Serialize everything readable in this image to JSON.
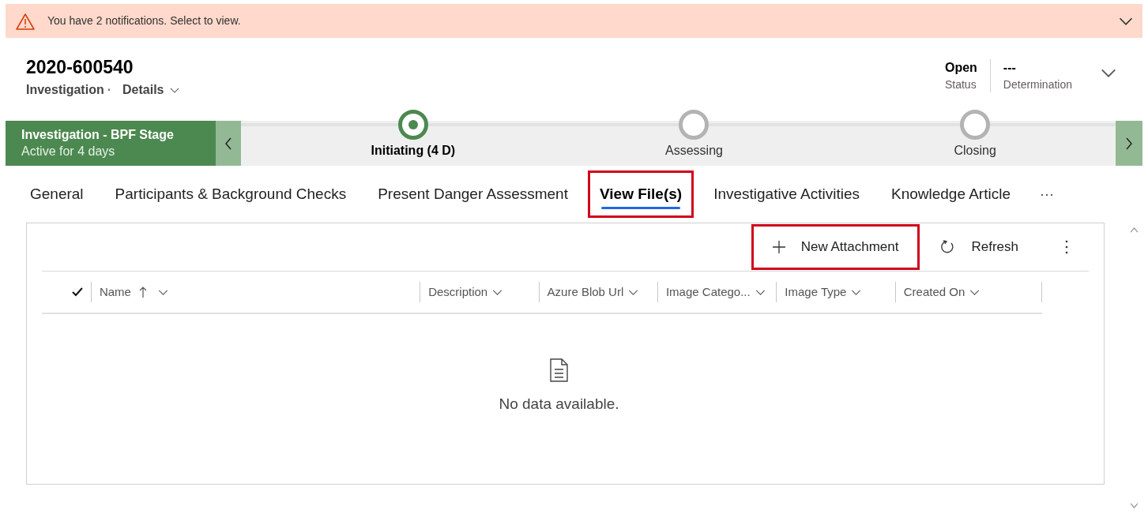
{
  "notification": {
    "text": "You have 2 notifications. Select to view."
  },
  "record": {
    "title": "2020-600540",
    "entity": "Investigation",
    "separator": "·",
    "form": "Details"
  },
  "header_fields": [
    {
      "value": "Open",
      "label": "Status"
    },
    {
      "value": "---",
      "label": "Determination"
    }
  ],
  "process": {
    "name": "Investigation - BPF Stage",
    "duration": "Active for 4 days",
    "stages": [
      {
        "label": "Initiating  (4 D)",
        "selected": true
      },
      {
        "label": "Assessing",
        "selected": false
      },
      {
        "label": "Closing",
        "selected": false
      }
    ]
  },
  "tabs": [
    {
      "label": "General",
      "selected": false,
      "highlighted": false
    },
    {
      "label": "Participants & Background Checks",
      "selected": false,
      "highlighted": false
    },
    {
      "label": "Present Danger Assessment",
      "selected": false,
      "highlighted": false
    },
    {
      "label": "View File(s)",
      "selected": true,
      "highlighted": true
    },
    {
      "label": "Investigative Activities",
      "selected": false,
      "highlighted": false
    },
    {
      "label": "Knowledge Article",
      "selected": false,
      "highlighted": false
    }
  ],
  "tabs_more": "···",
  "commands": [
    {
      "kind": "add",
      "label": "New Attachment",
      "highlighted": true
    },
    {
      "kind": "refresh",
      "label": "Refresh",
      "highlighted": false
    }
  ],
  "grid": {
    "columns": [
      {
        "label": "Name",
        "sorted": true
      },
      {
        "label": "Description",
        "sorted": false
      },
      {
        "label": "Azure Blob Url",
        "sorted": false
      },
      {
        "label": "Image Catego...",
        "sorted": false
      },
      {
        "label": "Image Type",
        "sorted": false
      },
      {
        "label": "Created On",
        "sorted": false
      }
    ],
    "empty_message": "No data available."
  }
}
